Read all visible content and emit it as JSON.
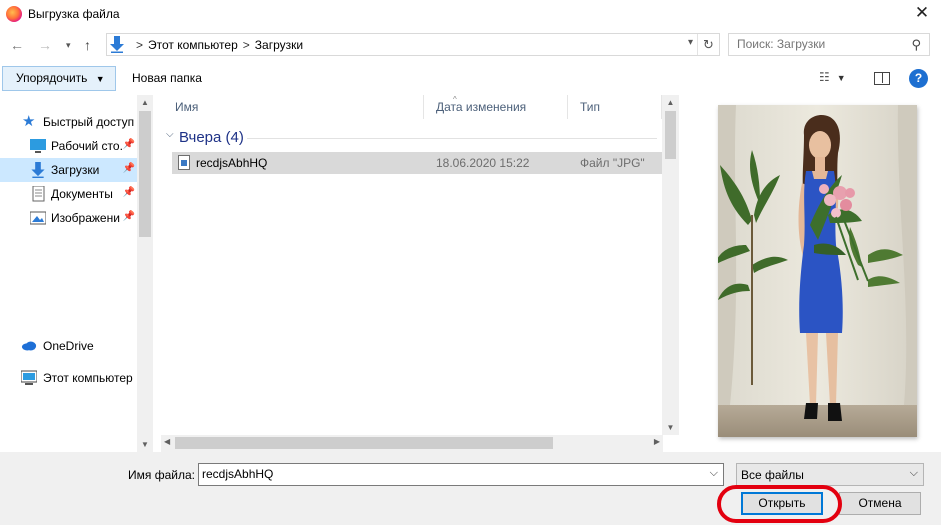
{
  "window": {
    "title": "Выгрузка файла",
    "close_glyph": "✕"
  },
  "address": {
    "breadcrumbs": [
      "Этот компьютер",
      "Загрузки"
    ],
    "separator": ">"
  },
  "search": {
    "placeholder": "Поиск: Загрузки"
  },
  "toolbar": {
    "organize_label": "Упорядочить",
    "new_folder_label": "Новая папка",
    "help_glyph": "?"
  },
  "nav": {
    "items": [
      {
        "label": "Быстрый доступ",
        "icon": "star-icon"
      },
      {
        "label": "Рабочий сто.",
        "icon": "desktop-icon",
        "pinned": true
      },
      {
        "label": "Загрузки",
        "icon": "downloads-icon",
        "pinned": true,
        "selected": true
      },
      {
        "label": "Документы",
        "icon": "documents-icon",
        "pinned": true
      },
      {
        "label": "Изображени",
        "icon": "pictures-icon",
        "pinned": true
      },
      {
        "label": "OneDrive",
        "icon": "onedrive-icon"
      },
      {
        "label": "Этот компьютер",
        "icon": "computer-icon"
      }
    ]
  },
  "filelist": {
    "columns": [
      "Имя",
      "Дата изменения",
      "Тип"
    ],
    "groups": [
      {
        "label": "Вчера (4)",
        "files": [
          {
            "name": "recdjsAbhHQ",
            "date": "18.06.2020 15:22",
            "type": "Файл \"JPG\"",
            "selected": true
          }
        ]
      }
    ]
  },
  "bottom": {
    "filename_label": "Имя файла:",
    "filename_value": "recdjsAbhHQ",
    "filter_label": "Все файлы",
    "open_label": "Открыть",
    "cancel_label": "Отмена"
  },
  "colors": {
    "selection": "#cce8ff",
    "highlight_ring": "#e3000f",
    "dress": "#2b54c4",
    "accent": "#0078d7"
  }
}
